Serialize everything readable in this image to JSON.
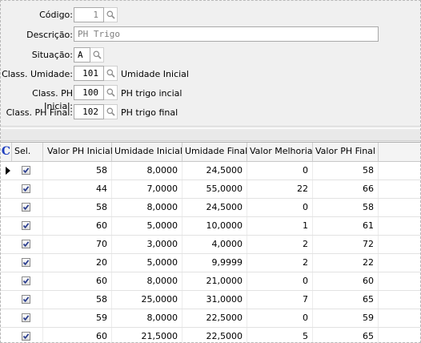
{
  "form": {
    "codigo": {
      "label": "Código:",
      "value": "1"
    },
    "descricao": {
      "label": "Descrição:",
      "value": "PH Trigo"
    },
    "situacao": {
      "label": "Situação:",
      "value": "A"
    },
    "class_umidade": {
      "label": "Class. Umidade:",
      "value": "101",
      "desc": "Umidade Inicial"
    },
    "class_ph_inicial": {
      "label": "Class. PH Inicial:",
      "value": "100",
      "desc": "PH trigo incial"
    },
    "class_ph_final": {
      "label": "Class. PH Final:",
      "value": "102",
      "desc": "PH trigo final"
    }
  },
  "grid": {
    "corner": "C",
    "columns": [
      "Sel.",
      "Valor PH Inicial",
      "Umidade Inicial",
      "Umidade Final",
      "Valor Melhoria",
      "Valor PH Final"
    ],
    "rows": [
      {
        "sel": true,
        "ph_ini": "58",
        "um_ini": "8,0000",
        "um_fin": "24,5000",
        "melhoria": "0",
        "ph_fin": "58",
        "current": true
      },
      {
        "sel": true,
        "ph_ini": "44",
        "um_ini": "7,0000",
        "um_fin": "55,0000",
        "melhoria": "22",
        "ph_fin": "66"
      },
      {
        "sel": true,
        "ph_ini": "58",
        "um_ini": "8,0000",
        "um_fin": "24,5000",
        "melhoria": "0",
        "ph_fin": "58"
      },
      {
        "sel": true,
        "ph_ini": "60",
        "um_ini": "5,0000",
        "um_fin": "10,0000",
        "melhoria": "1",
        "ph_fin": "61"
      },
      {
        "sel": true,
        "ph_ini": "70",
        "um_ini": "3,0000",
        "um_fin": "4,0000",
        "melhoria": "2",
        "ph_fin": "72"
      },
      {
        "sel": true,
        "ph_ini": "20",
        "um_ini": "5,0000",
        "um_fin": "9,9999",
        "melhoria": "2",
        "ph_fin": "22"
      },
      {
        "sel": true,
        "ph_ini": "60",
        "um_ini": "8,0000",
        "um_fin": "21,0000",
        "melhoria": "0",
        "ph_fin": "60"
      },
      {
        "sel": true,
        "ph_ini": "58",
        "um_ini": "25,0000",
        "um_fin": "31,0000",
        "melhoria": "7",
        "ph_fin": "65"
      },
      {
        "sel": true,
        "ph_ini": "59",
        "um_ini": "8,0000",
        "um_fin": "22,5000",
        "melhoria": "0",
        "ph_fin": "59"
      },
      {
        "sel": true,
        "ph_ini": "60",
        "um_ini": "21,5000",
        "um_fin": "22,5000",
        "melhoria": "5",
        "ph_fin": "65"
      }
    ]
  }
}
